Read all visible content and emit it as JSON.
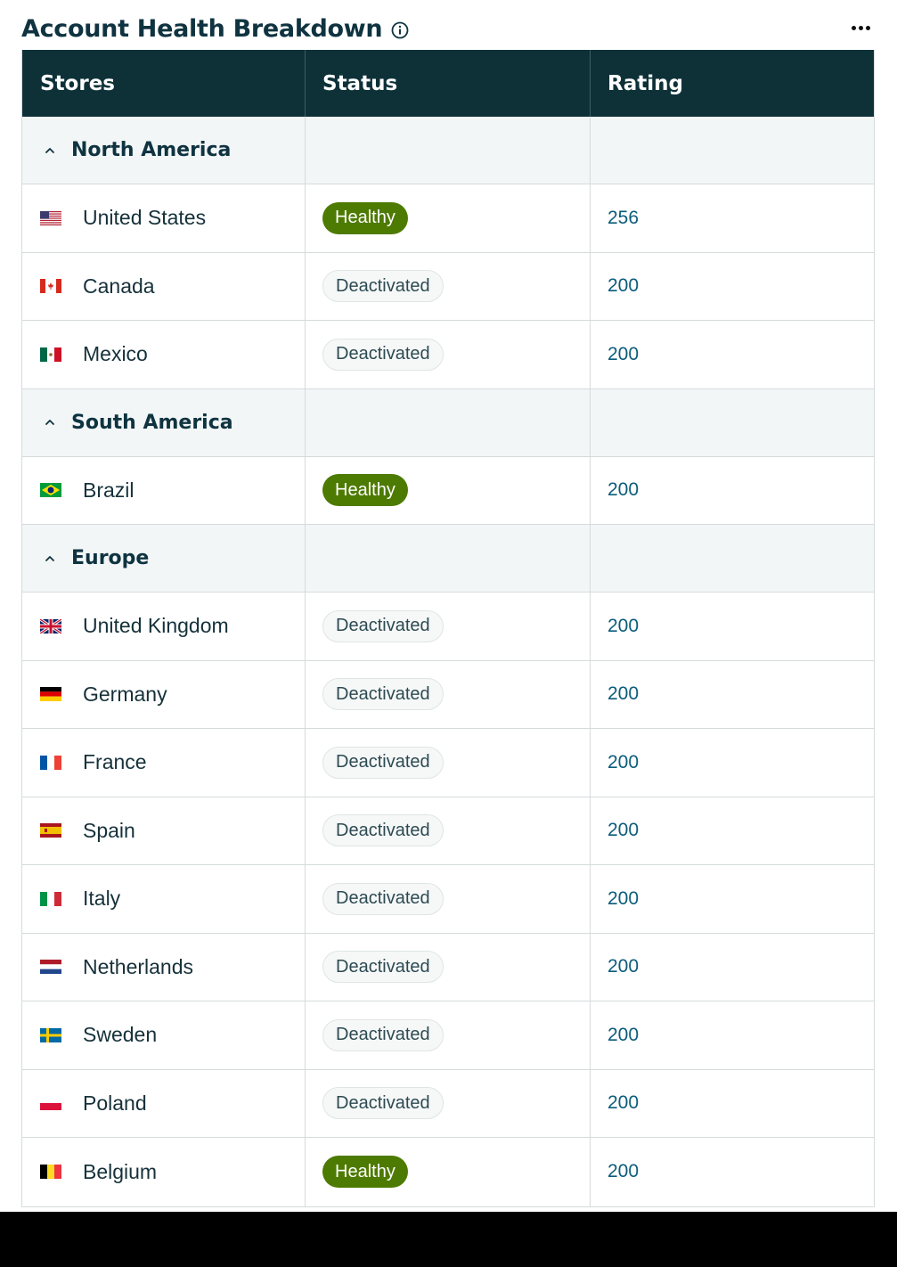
{
  "title": "Account Health Breakdown",
  "icons": {
    "info": "info-icon",
    "more": "more-options-icon",
    "collapse": "chevron-up-icon"
  },
  "colors": {
    "header_bg": "#0e3138",
    "healthy": "#4d7a00",
    "rating_link": "#0b5c7b",
    "group_bg": "#f2f6f7"
  },
  "columns": {
    "stores": "Stores",
    "status": "Status",
    "rating": "Rating"
  },
  "groups": [
    {
      "name": "North America",
      "stores": [
        {
          "name": "United States",
          "flag": "us",
          "status": "Healthy",
          "rating": "256"
        },
        {
          "name": "Canada",
          "flag": "ca",
          "status": "Deactivated",
          "rating": "200"
        },
        {
          "name": "Mexico",
          "flag": "mx",
          "status": "Deactivated",
          "rating": "200"
        }
      ]
    },
    {
      "name": "South America",
      "stores": [
        {
          "name": "Brazil",
          "flag": "br",
          "status": "Healthy",
          "rating": "200"
        }
      ]
    },
    {
      "name": "Europe",
      "stores": [
        {
          "name": "United Kingdom",
          "flag": "gb",
          "status": "Deactivated",
          "rating": "200"
        },
        {
          "name": "Germany",
          "flag": "de",
          "status": "Deactivated",
          "rating": "200"
        },
        {
          "name": "France",
          "flag": "fr",
          "status": "Deactivated",
          "rating": "200"
        },
        {
          "name": "Spain",
          "flag": "es",
          "status": "Deactivated",
          "rating": "200"
        },
        {
          "name": "Italy",
          "flag": "it",
          "status": "Deactivated",
          "rating": "200"
        },
        {
          "name": "Netherlands",
          "flag": "nl",
          "status": "Deactivated",
          "rating": "200"
        },
        {
          "name": "Sweden",
          "flag": "se",
          "status": "Deactivated",
          "rating": "200"
        },
        {
          "name": "Poland",
          "flag": "pl",
          "status": "Deactivated",
          "rating": "200"
        },
        {
          "name": "Belgium",
          "flag": "be",
          "status": "Healthy",
          "rating": "200"
        }
      ]
    }
  ]
}
